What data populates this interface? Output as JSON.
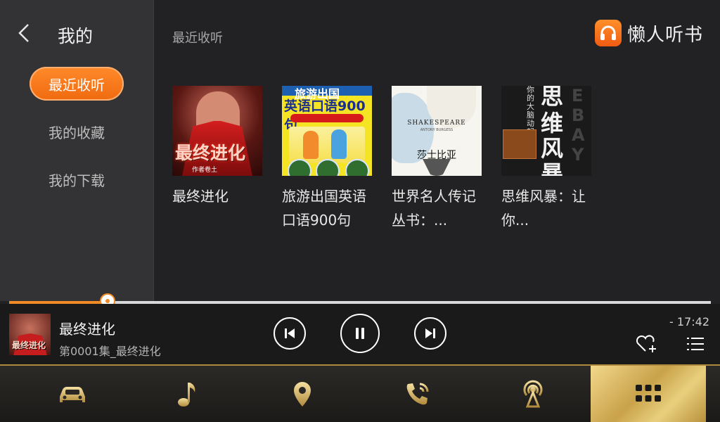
{
  "sidebar": {
    "title": "我的",
    "items": [
      {
        "label": "最近收听",
        "active": true
      },
      {
        "label": "我的收藏",
        "active": false
      },
      {
        "label": "我的下载",
        "active": false
      }
    ]
  },
  "main": {
    "section_title": "最近收听",
    "brand_name": "懒人听书",
    "books": [
      {
        "title": "最终进化",
        "cover_text": "最终进化",
        "cover_sub": "作者卷土"
      },
      {
        "title": "旅游出国英语口语900句",
        "cover_text": "英语口语900句",
        "cover_top": "旅游出国"
      },
      {
        "title": "世界名人传记丛书：...",
        "cover_text": "SHAKESPEARE",
        "cover_sub": "ANTONY BURGESS",
        "cover_cn": "莎士比亚"
      },
      {
        "title": "思维风暴：让你...",
        "cover_chars": [
          "思",
          "维",
          "风",
          "暴"
        ],
        "cover_side": "你的大脑动起来"
      }
    ]
  },
  "player": {
    "progress": 0.14,
    "track_title": "最终进化",
    "episode": "第0001集_最终进化",
    "thumb_text": "最终进化",
    "remaining_time": "- 17:42",
    "state": "playing"
  },
  "nav": {
    "items": [
      {
        "icon": "car-icon"
      },
      {
        "icon": "music-note-icon"
      },
      {
        "icon": "location-pin-icon"
      },
      {
        "icon": "phone-icon"
      },
      {
        "icon": "radio-antenna-icon"
      },
      {
        "icon": "apps-grid-icon",
        "active": true
      }
    ]
  },
  "colors": {
    "accent": "#f08a24",
    "gold": "#c9a24a",
    "sidebar_bg": "#333335",
    "main_bg": "#222224"
  }
}
